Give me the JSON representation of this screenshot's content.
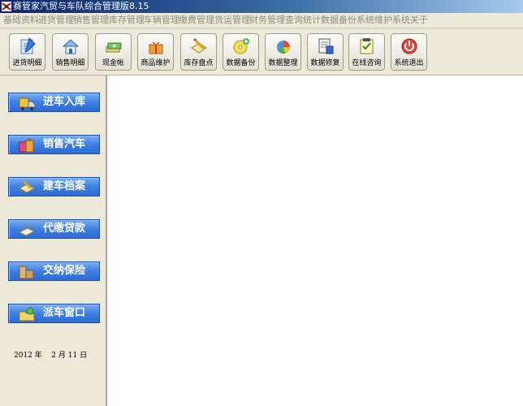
{
  "window": {
    "title": "赛管家汽贸与车队综合管理版8.15"
  },
  "menu": [
    "基础资料",
    "进货管理",
    "销售管理",
    "库存管理",
    "车辆管理",
    "缴费管理",
    "货运管理",
    "财务管理",
    "查询统计",
    "数据备份",
    "系统维护",
    "系统关于"
  ],
  "toolbar": [
    {
      "label": "进货明细",
      "icon": "pen-document-icon"
    },
    {
      "label": "销售明细",
      "icon": "house-box-icon"
    },
    {
      "label": "现金帐",
      "icon": "cash-stack-icon"
    },
    {
      "label": "商品维护",
      "icon": "gift-box-icon"
    },
    {
      "label": "库存盘点",
      "icon": "checklist-pencil-icon"
    },
    {
      "label": "数据备份",
      "icon": "disk-add-icon"
    },
    {
      "label": "数据整理",
      "icon": "pie-chart-icon"
    },
    {
      "label": "数据修复",
      "icon": "database-wrench-icon"
    },
    {
      "label": "在线咨询",
      "icon": "notepad-check-icon"
    },
    {
      "label": "系统退出",
      "icon": "power-icon"
    }
  ],
  "sidebar": [
    {
      "label": "进车入库",
      "icon": "truck-load-icon"
    },
    {
      "label": "销售汽车",
      "icon": "shopping-bags-icon"
    },
    {
      "label": "建车档案",
      "icon": "notebook-pencil-icon"
    },
    {
      "label": "代缴贷款",
      "icon": "money-bills-icon"
    },
    {
      "label": "交纳保险",
      "icon": "insurance-boxes-icon"
    },
    {
      "label": "派车窗口",
      "icon": "dispatch-folder-icon"
    }
  ],
  "date": {
    "year": "2012",
    "year_unit": "年",
    "month": "2",
    "month_unit": "月",
    "day": "11",
    "day_unit": "日"
  },
  "colors": {
    "window_bg": "#ece9d8",
    "sidebar_button": "#3e7fe0",
    "content_bg": "#ffffff",
    "title_start": "#0a246a",
    "title_end": "#a6caf0"
  }
}
